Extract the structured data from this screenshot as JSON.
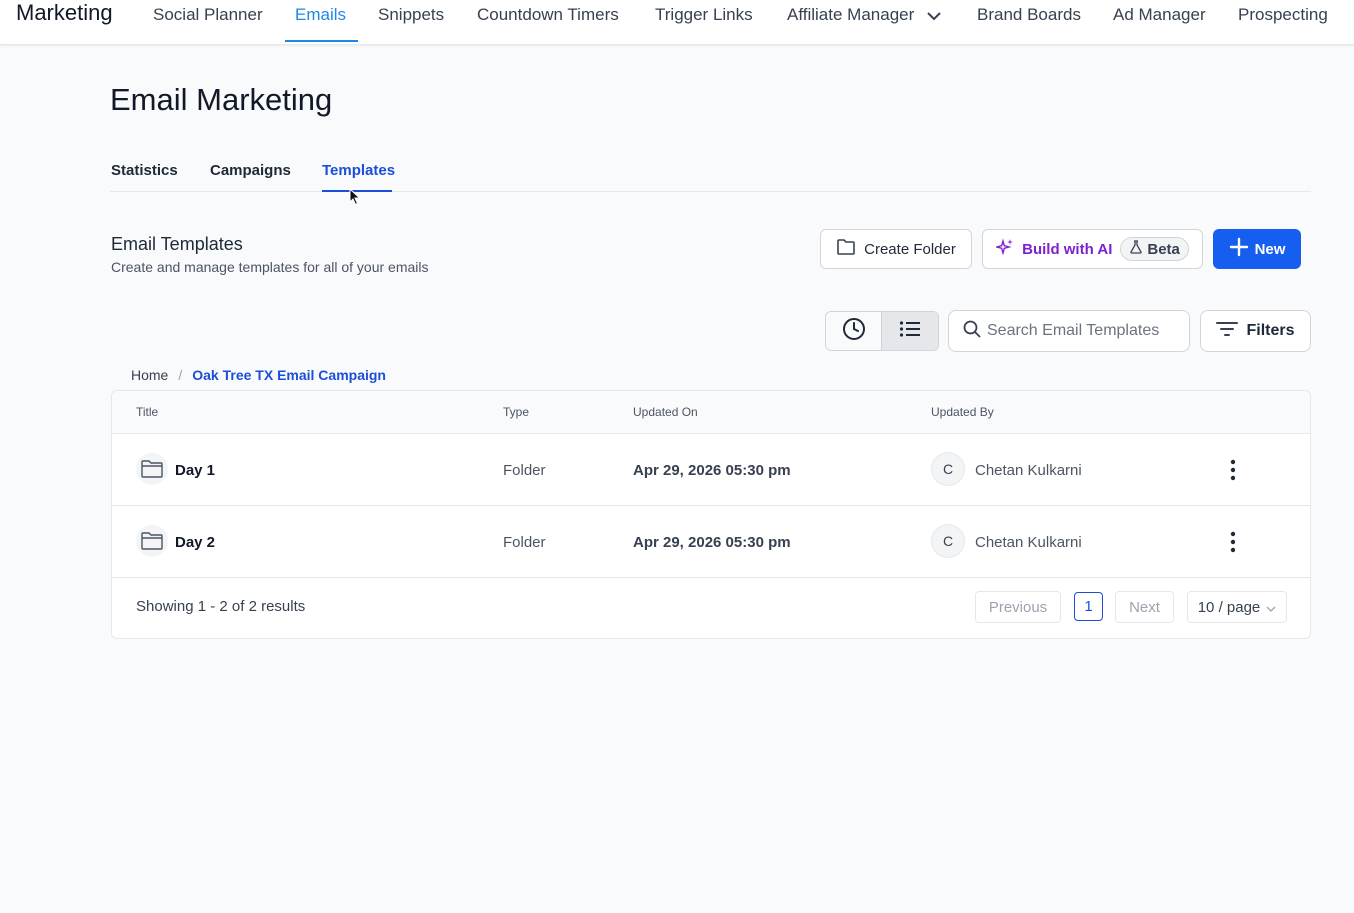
{
  "topnav": {
    "brand": "Marketing",
    "items": [
      {
        "label": "Social Planner"
      },
      {
        "label": "Emails"
      },
      {
        "label": "Snippets"
      },
      {
        "label": "Countdown Timers"
      },
      {
        "label": "Trigger Links"
      },
      {
        "label": "Affiliate Manager"
      },
      {
        "label": "Brand Boards"
      },
      {
        "label": "Ad Manager"
      },
      {
        "label": "Prospecting"
      }
    ],
    "active_item": "Emails"
  },
  "page": {
    "title": "Email Marketing",
    "tabs": [
      {
        "label": "Statistics"
      },
      {
        "label": "Campaigns"
      },
      {
        "label": "Templates"
      }
    ],
    "active_tab": "Templates"
  },
  "section": {
    "title": "Email Templates",
    "subtitle": "Create and manage templates for all of your emails"
  },
  "actions": {
    "create_folder": "Create Folder",
    "build_ai": "Build with AI",
    "beta": "Beta",
    "new": "New"
  },
  "search": {
    "placeholder": "Search Email Templates"
  },
  "filters_label": "Filters",
  "breadcrumb": {
    "home": "Home",
    "separator": "/",
    "current": "Oak Tree TX Email Campaign"
  },
  "table": {
    "headers": {
      "title": "Title",
      "type": "Type",
      "updated_on": "Updated On",
      "updated_by": "Updated By"
    },
    "rows": [
      {
        "title": "Day 1",
        "type": "Folder",
        "updated_on": "Apr 29, 2026 05:30 pm",
        "avatar": "C",
        "updated_by": "Chetan Kulkarni"
      },
      {
        "title": "Day 2",
        "type": "Folder",
        "updated_on": "Apr 29, 2026 05:30 pm",
        "avatar": "C",
        "updated_by": "Chetan Kulkarni"
      }
    ]
  },
  "pagination": {
    "summary": "Showing 1 - 2 of 2 results",
    "previous": "Previous",
    "current_page": "1",
    "next": "Next",
    "page_size": "10 / page"
  },
  "colors": {
    "primary": "#155eef",
    "nav_active": "#1e88e5",
    "ai_purple": "#7e22ce"
  }
}
